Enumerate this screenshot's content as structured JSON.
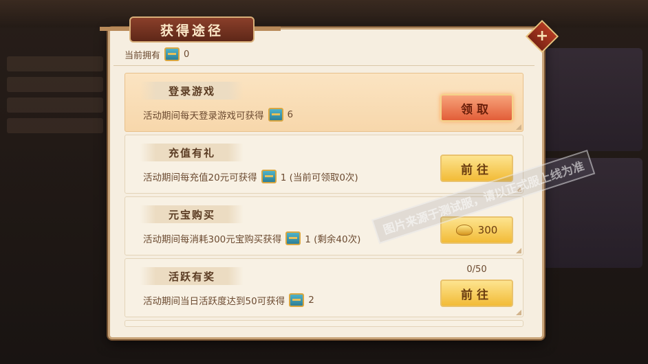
{
  "dialog": {
    "title": "获得途径",
    "close_label": "+",
    "owned_label": "当前拥有",
    "owned_count": "0"
  },
  "rows": [
    {
      "label": "登录游戏",
      "desc": "活动期间每天登录游戏可获得",
      "reward": "6",
      "button": "领取",
      "button_style": "orange"
    },
    {
      "label": "充值有礼",
      "desc": "活动期间每充值20元可获得",
      "reward": "1 (当前可领取0次)",
      "button": "前往",
      "button_style": "gold"
    },
    {
      "label": "元宝购买",
      "desc": "活动期间每消耗300元宝购买获得",
      "reward": "1 (剩余40次)",
      "button": "300",
      "button_style": "gold-price"
    },
    {
      "label": "活跃有奖",
      "desc": "活动期间当日活跃度达到50可获得",
      "reward": "2",
      "button": "前往",
      "button_style": "gold",
      "progress": "0/50"
    }
  ],
  "watermark": {
    "text": "图片来源于测试服，请以正式服上线为准"
  },
  "colors": {
    "dialog_bg": "#f6eee0",
    "title_bg": "#6f2f1e",
    "orange_button": "#e25d38",
    "gold_button": "#f2bb37"
  },
  "icons": {
    "reward": "treasure-chest-icon",
    "currency": "gold-ingot-icon",
    "close": "close-icon"
  }
}
